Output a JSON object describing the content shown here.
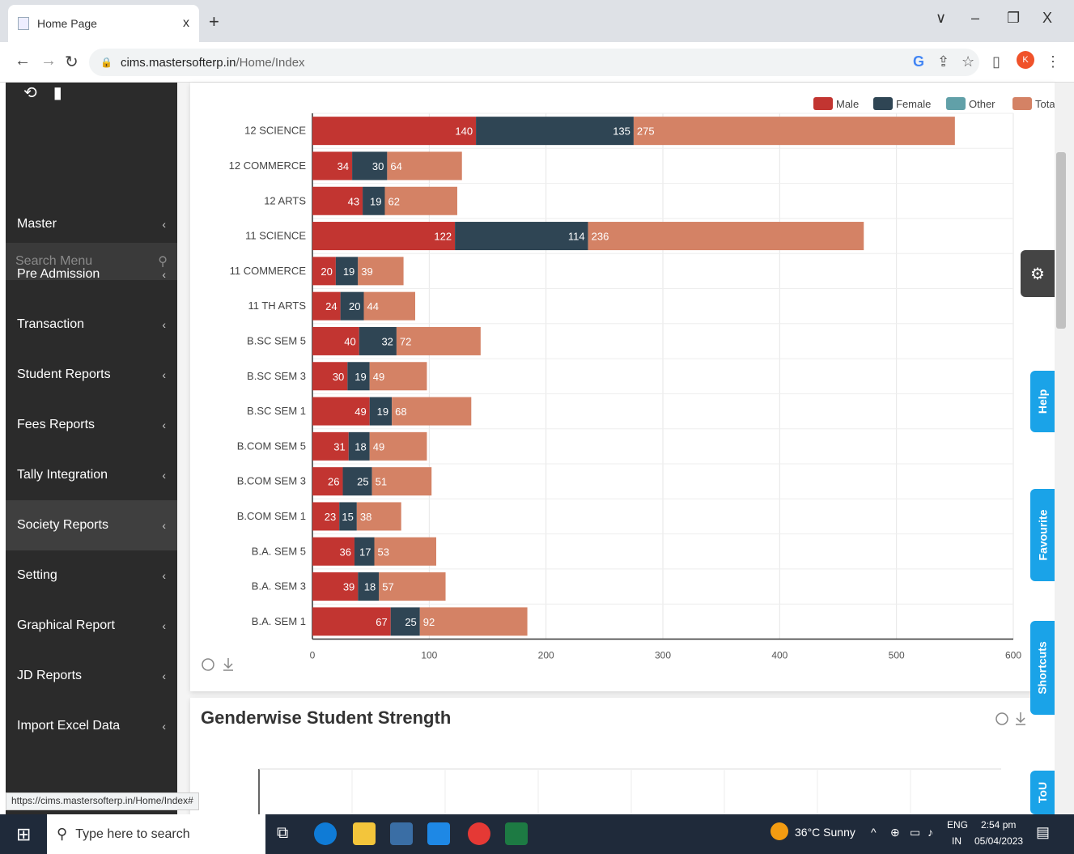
{
  "browser": {
    "tab_title": "Home Page",
    "tab_close": "x",
    "new_tab": "+",
    "url_host": "cims.mastersofterp.in",
    "url_path": "/Home/Index",
    "avatar_letter": "K",
    "win_menu": "∨",
    "win_min": "–",
    "win_max": "❐",
    "win_close": "X"
  },
  "sidebar": {
    "search_placeholder": "Search Menu",
    "items": [
      {
        "label": "Master"
      },
      {
        "label": "Pre Admission"
      },
      {
        "label": "Transaction"
      },
      {
        "label": "Student Reports"
      },
      {
        "label": "Fees Reports"
      },
      {
        "label": "Tally Integration"
      },
      {
        "label": "Society Reports"
      },
      {
        "label": "Setting"
      },
      {
        "label": "Graphical Report"
      },
      {
        "label": "JD Reports"
      },
      {
        "label": "Import Excel Data"
      }
    ],
    "active_item": "Society Reports"
  },
  "status_url": "https://cims.mastersofterp.in/Home/Index#",
  "chart_data": {
    "type": "bar",
    "orientation": "horizontal",
    "stacked": true,
    "categories": [
      "12 SCIENCE",
      "12 COMMERCE",
      "12 ARTS",
      "11 SCIENCE",
      "11 COMMERCE",
      "11 TH ARTS",
      "B.SC SEM 5",
      "B.SC SEM 3",
      "B.SC SEM 1",
      "B.COM SEM 5",
      "B.COM SEM 3",
      "B.COM SEM 1",
      "B.A. SEM 5",
      "B.A. SEM 3",
      "B.A. SEM 1"
    ],
    "series": [
      {
        "name": "Male",
        "color": "#c23531",
        "values": [
          140,
          34,
          43,
          122,
          20,
          24,
          40,
          30,
          49,
          31,
          26,
          23,
          36,
          39,
          67
        ]
      },
      {
        "name": "Female",
        "color": "#2f4554",
        "values": [
          135,
          30,
          19,
          114,
          19,
          20,
          32,
          19,
          19,
          18,
          25,
          15,
          17,
          18,
          25
        ]
      },
      {
        "name": "Other",
        "color": "#61a0a8",
        "values": [
          0,
          0,
          0,
          0,
          0,
          0,
          0,
          0,
          0,
          0,
          0,
          0,
          0,
          0,
          0
        ]
      },
      {
        "name": "Total",
        "color": "#d48265",
        "values": [
          275,
          64,
          62,
          236,
          39,
          44,
          72,
          49,
          68,
          49,
          51,
          38,
          53,
          57,
          92
        ]
      }
    ],
    "x_ticks": [
      "0",
      "100",
      "200",
      "300",
      "400",
      "500",
      "600"
    ],
    "xlim": [
      0,
      600
    ],
    "grid": true,
    "legend_position": "top-right"
  },
  "card2": {
    "title": "Genderwise Student Strength"
  },
  "right_tabs": {
    "help": "Help",
    "favourite": "Favourite",
    "shortcuts": "Shortcuts",
    "tou": "ToU"
  },
  "taskbar": {
    "search_placeholder": "Type here to search",
    "weather": "36°C  Sunny",
    "lang": "ENG",
    "region": "IN",
    "time": "2:54 pm",
    "date": "05/04/2023"
  }
}
